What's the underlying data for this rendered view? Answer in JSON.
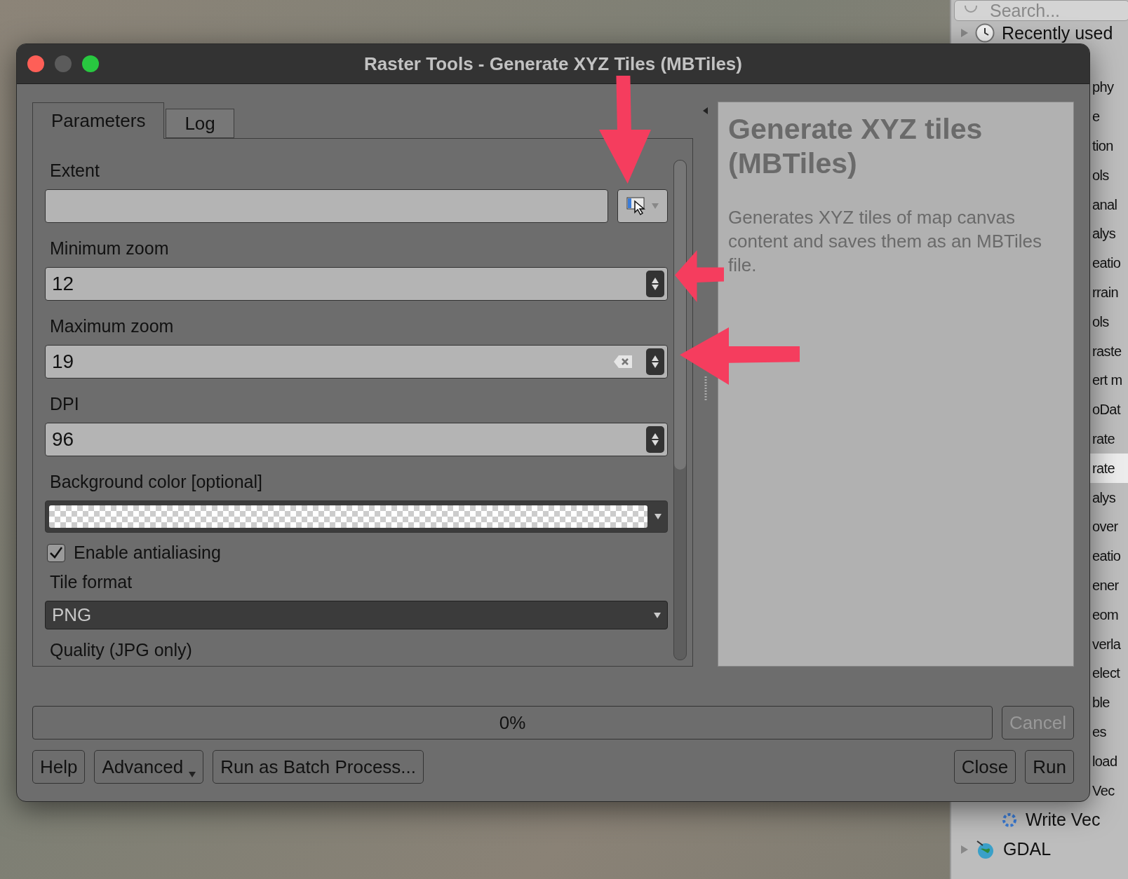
{
  "toolbox": {
    "search_placeholder": "Search...",
    "items": [
      {
        "label": "Recently used",
        "kind": "recent",
        "selected": false
      },
      {
        "label": "phy",
        "kind": "fragment",
        "selected": false
      },
      {
        "label": "e",
        "kind": "fragment",
        "selected": false
      },
      {
        "label": "tion",
        "kind": "fragment",
        "selected": false
      },
      {
        "label": "ols",
        "kind": "fragment",
        "selected": false
      },
      {
        "label": "anal",
        "kind": "fragment",
        "selected": false
      },
      {
        "label": "alys",
        "kind": "fragment",
        "selected": false
      },
      {
        "label": "eatio",
        "kind": "fragment",
        "selected": false
      },
      {
        "label": "rrain",
        "kind": "fragment",
        "selected": false
      },
      {
        "label": "ols",
        "kind": "fragment",
        "selected": false
      },
      {
        "label": "raste",
        "kind": "fragment",
        "selected": false
      },
      {
        "label": "ert m",
        "kind": "fragment",
        "selected": false
      },
      {
        "label": "oDat",
        "kind": "fragment",
        "selected": false
      },
      {
        "label": "rate",
        "kind": "fragment",
        "selected": false
      },
      {
        "label": "rate",
        "kind": "fragment",
        "selected": true
      },
      {
        "label": "alys",
        "kind": "fragment",
        "selected": false
      },
      {
        "label": "over",
        "kind": "fragment",
        "selected": false
      },
      {
        "label": "eatio",
        "kind": "fragment",
        "selected": false
      },
      {
        "label": "ener",
        "kind": "fragment",
        "selected": false
      },
      {
        "label": "eom",
        "kind": "fragment",
        "selected": false
      },
      {
        "label": "verla",
        "kind": "fragment",
        "selected": false
      },
      {
        "label": "elect",
        "kind": "fragment",
        "selected": false
      },
      {
        "label": "ble",
        "kind": "fragment",
        "selected": false
      },
      {
        "label": "es",
        "kind": "fragment",
        "selected": false
      },
      {
        "label": "load",
        "kind": "fragment",
        "selected": false
      },
      {
        "label": "Vec",
        "kind": "fragment",
        "selected": false
      },
      {
        "label": "Write Vec",
        "kind": "algorithm",
        "selected": false
      },
      {
        "label": "GDAL",
        "kind": "provider",
        "selected": false
      }
    ]
  },
  "dialog": {
    "title": "Raster Tools - Generate XYZ Tiles (MBTiles)",
    "tabs": [
      {
        "label": "Parameters",
        "selected": true
      },
      {
        "label": "Log",
        "selected": false
      }
    ],
    "parameters": [
      {
        "kind": "extent",
        "label": "Extent"
      },
      {
        "kind": "spin",
        "label": "Minimum zoom",
        "value": "12",
        "clearable": false
      },
      {
        "kind": "spin",
        "label": "Maximum zoom",
        "value": "19",
        "clearable": true
      },
      {
        "kind": "spin",
        "label": "DPI",
        "value": "96",
        "clearable": false
      },
      {
        "kind": "color",
        "label": "Background color [optional]"
      },
      {
        "kind": "checkbox",
        "label": "Enable antialiasing",
        "checked": true
      },
      {
        "kind": "select",
        "label": "Tile format",
        "value": "PNG"
      },
      {
        "kind": "heading",
        "label": "Quality (JPG only)"
      }
    ],
    "help": {
      "title": "Generate XYZ tiles (MBTiles)",
      "description": "Generates XYZ tiles of map canvas content and saves them as an MBTiles file."
    },
    "progress": {
      "level": 0,
      "reading": "0%"
    },
    "cancel": {
      "label": "Cancel",
      "disabled": true
    },
    "left_buttons": [
      {
        "label": "Help",
        "kind": "plain"
      },
      {
        "label": "Advanced",
        "kind": "menu"
      },
      {
        "label": "Run as Batch Process...",
        "kind": "plain"
      }
    ],
    "right_buttons": [
      {
        "label": "Close"
      },
      {
        "label": "Run"
      }
    ]
  },
  "annotations": [
    {
      "kind": "down_arrow"
    },
    {
      "kind": "left_arrow"
    },
    {
      "kind": "left_arrow"
    }
  ]
}
